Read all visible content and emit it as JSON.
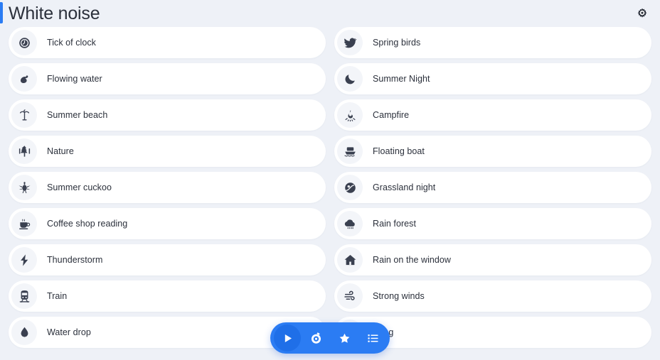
{
  "header": {
    "title": "White noise",
    "accent_color": "#2b7cf3",
    "settings_icon": "gear-icon"
  },
  "theme": {
    "background": "#eef1f7",
    "card_background": "#ffffff",
    "icon_circle_background": "#f3f5f9",
    "text_color": "#2b303b",
    "accent": "#2b7cf3",
    "accent_dark": "#1f6fe8"
  },
  "sounds": [
    {
      "label": "Tick of clock",
      "icon": "clock-icon",
      "column": "left"
    },
    {
      "label": "Spring birds",
      "icon": "bird-icon",
      "column": "right"
    },
    {
      "label": "Flowing water",
      "icon": "water-flow-icon",
      "column": "left"
    },
    {
      "label": "Summer Night",
      "icon": "moon-icon",
      "column": "right"
    },
    {
      "label": "Summer beach",
      "icon": "palm-tree-icon",
      "column": "left"
    },
    {
      "label": "Campfire",
      "icon": "campfire-icon",
      "column": "right"
    },
    {
      "label": "Nature",
      "icon": "tree-icon",
      "column": "left"
    },
    {
      "label": "Floating boat",
      "icon": "boat-icon",
      "column": "right"
    },
    {
      "label": "Summer cuckoo",
      "icon": "cuckoo-bird-icon",
      "column": "left"
    },
    {
      "label": "Grassland night",
      "icon": "grassland-icon",
      "column": "right"
    },
    {
      "label": "Coffee shop reading",
      "icon": "coffee-cup-icon",
      "column": "left"
    },
    {
      "label": "Rain forest",
      "icon": "rain-cloud-icon",
      "column": "right"
    },
    {
      "label": "Thunderstorm",
      "icon": "lightning-icon",
      "column": "left"
    },
    {
      "label": "Rain on the window",
      "icon": "house-icon",
      "column": "right"
    },
    {
      "label": "Train",
      "icon": "train-icon",
      "column": "left"
    },
    {
      "label": "Strong winds",
      "icon": "wind-icon",
      "column": "right"
    },
    {
      "label": "Water drop",
      "icon": "water-drop-icon",
      "column": "left"
    },
    {
      "label": "Pong",
      "icon": "ping-pong-icon",
      "column": "right"
    }
  ],
  "action_bar": {
    "buttons": [
      {
        "name": "play-button",
        "icon": "play-icon",
        "label": "Play"
      },
      {
        "name": "timer-button",
        "icon": "timer-icon",
        "label": "Timer"
      },
      {
        "name": "favorites-button",
        "icon": "star-icon",
        "label": "Favorites"
      },
      {
        "name": "playlist-button",
        "icon": "list-icon",
        "label": "Playlist"
      }
    ]
  }
}
